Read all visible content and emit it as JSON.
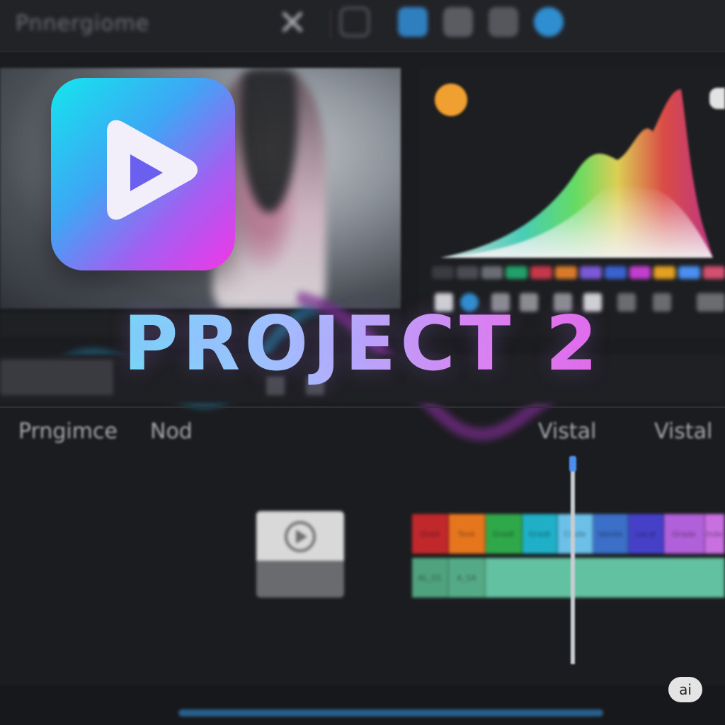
{
  "topbar": {
    "app_name": "Pnnergiome",
    "icons": [
      "scissors-icon",
      "crop-icon",
      "media-icon",
      "grid-icon",
      "layers-icon",
      "export-icon"
    ]
  },
  "logo": {
    "icon": "play-icon",
    "colors": [
      "#14e6ee",
      "#3ea6f4",
      "#a45ef2",
      "#f236e6"
    ]
  },
  "title": "PROJECT 2",
  "scope": {
    "type": "rgb-histogram",
    "swatches": [
      "#3a3b40",
      "#4a4c52",
      "#6a6d74",
      "#22a06b",
      "#c4384a",
      "#d97a2a",
      "#7a5ad6",
      "#3a62d0",
      "#c23fd0",
      "#e4a020",
      "#4a8ef0",
      "#d25070"
    ]
  },
  "timeline": {
    "labels": {
      "left1": "Prngimce",
      "left2": "Nod",
      "right1": "Vistal",
      "right2": "Vistal"
    },
    "video_segments": [
      {
        "label": "Grad",
        "color": "#c0282c"
      },
      {
        "label": "Tonk",
        "color": "#e6761e"
      },
      {
        "label": "Gradt",
        "color": "#2fa84a"
      },
      {
        "label": "Gradt",
        "color": "#1fb0c8"
      },
      {
        "label": "Clode",
        "color": "#6cc0e8"
      },
      {
        "label": "Idente",
        "color": "#3b6fc8"
      },
      {
        "label": "Lecal",
        "color": "#4640c8"
      },
      {
        "label": "Grade",
        "color": "#b060d8"
      },
      {
        "label": "Inde",
        "color": "#c870e0"
      }
    ],
    "audio_segments": [
      {
        "label": "AL_01",
        "color": "#4fa27e"
      },
      {
        "label": "A_SA",
        "color": "#55aa86"
      },
      {
        "label": "",
        "color": "#62c1a0"
      }
    ]
  },
  "badge": {
    "label": "ai"
  }
}
